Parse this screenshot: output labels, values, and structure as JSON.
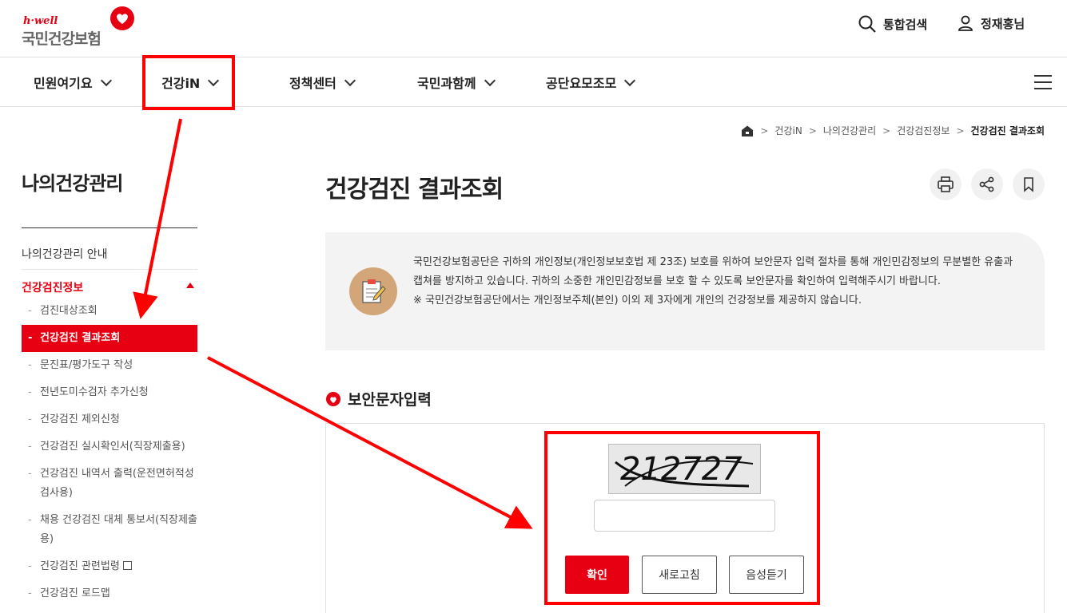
{
  "header": {
    "logo_sub": "h·well",
    "logo_main": "국민건강보험",
    "search_label": "통합검색",
    "user_label": "정재홍님"
  },
  "gnb": [
    {
      "label": "민원여기요"
    },
    {
      "label": "건강iN"
    },
    {
      "label": "정책센터"
    },
    {
      "label": "국민과함께"
    },
    {
      "label": "공단요모조모"
    }
  ],
  "breadcrumb": [
    "건강iN",
    "나의건강관리",
    "건강검진정보",
    "건강검진 결과조회"
  ],
  "lnb": {
    "title": "나의건강관리",
    "guide": "나의건강관리 안내",
    "active_group": "건강검진정보",
    "items": [
      "검진대상조회",
      "건강검진 결과조회",
      "문진표/평가도구 작성",
      "전년도미수검자 추가신청",
      "건강검진 제외신청",
      "건강검진 실시확인서(직장제출용)",
      "건강검진 내역서 출력(운전면허적성검사용)",
      "채용 건강검진 대체 통보서(직장제출용)",
      "건강검진 관련법령",
      "건강검진 로드맵"
    ]
  },
  "main": {
    "title": "건강검진 결과조회",
    "notice_line1": "국민건강보험공단은 귀하의 개인정보(개인정보보호법 제 23조) 보호를 위하여 보안문자 입력 절차를 통해 개인민감정보의 무분별한 유출과 캡쳐를 방지하고 있습니다. 귀하의 소중한 개인민감정보를 보호 할 수 있도록 보안문자를 확인하여 입력해주시기 바랍니다.",
    "notice_line2": "※ 국민건강보험공단에서는 개인정보주체(본인) 이외 제 3자에게 개인의 건강정보를 제공하지 않습니다.",
    "section_title": "보안문자입력",
    "captcha_text": "212727",
    "captcha_input": "",
    "confirm_label": "확인",
    "refresh_label": "새로고침",
    "audio_label": "음성듣기"
  },
  "colors": {
    "accent": "#e60012",
    "annotation": "#ff0000"
  }
}
